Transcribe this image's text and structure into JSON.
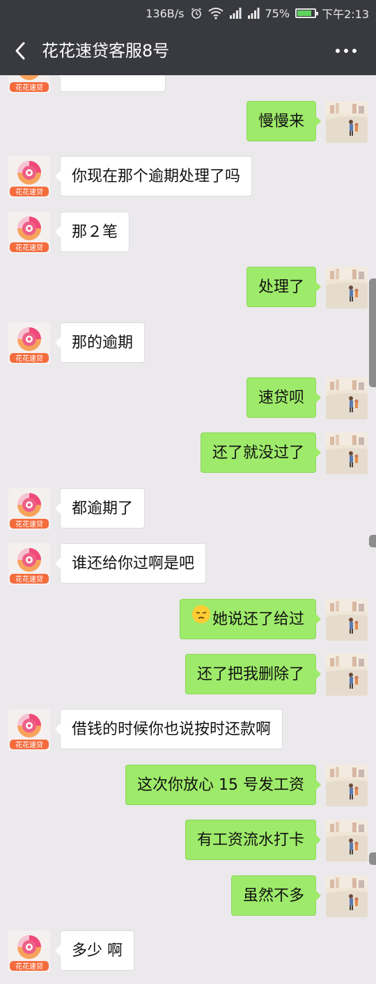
{
  "status_bar": {
    "speed": "136B/s",
    "battery_percent": "75%",
    "battery_level": 0.75,
    "time": "下午2:13"
  },
  "header": {
    "title": "花花速贷客服8号",
    "back_icon": "chevron-left-icon",
    "more_icon": "more-dots-icon"
  },
  "agent_avatar_label": "花花速贷",
  "messages": [
    {
      "side": "right",
      "text": "慢慢来"
    },
    {
      "side": "left",
      "text": "你现在那个逾期处理了吗"
    },
    {
      "side": "left",
      "text": "那２笔"
    },
    {
      "side": "right",
      "text": "处理了"
    },
    {
      "side": "left",
      "text": "那的逾期"
    },
    {
      "side": "right",
      "text": "速贷呗"
    },
    {
      "side": "right",
      "text": "还了就没过了"
    },
    {
      "side": "left",
      "text": "都逾期了"
    },
    {
      "side": "left",
      "text": "谁还给你过啊是吧"
    },
    {
      "side": "right",
      "text": "她说还了给过",
      "emoji": "pensive-face-icon"
    },
    {
      "side": "right",
      "text": "还了把我删除了"
    },
    {
      "side": "left",
      "text": "借钱的时候你也说按时还款啊"
    },
    {
      "side": "right",
      "text": "这次你放心 15 号发工资"
    },
    {
      "side": "right",
      "text": "有工资流水打卡"
    },
    {
      "side": "right",
      "text": "虽然不多"
    },
    {
      "side": "left",
      "text": "多少 啊"
    }
  ],
  "colors": {
    "bar": "#393a3f",
    "chat_bg": "#ebe9ec",
    "outgoing_bubble": "#9eea6a",
    "incoming_bubble": "#ffffff",
    "logo_pink": "#f04a7a",
    "logo_orange": "#f27a3c"
  }
}
